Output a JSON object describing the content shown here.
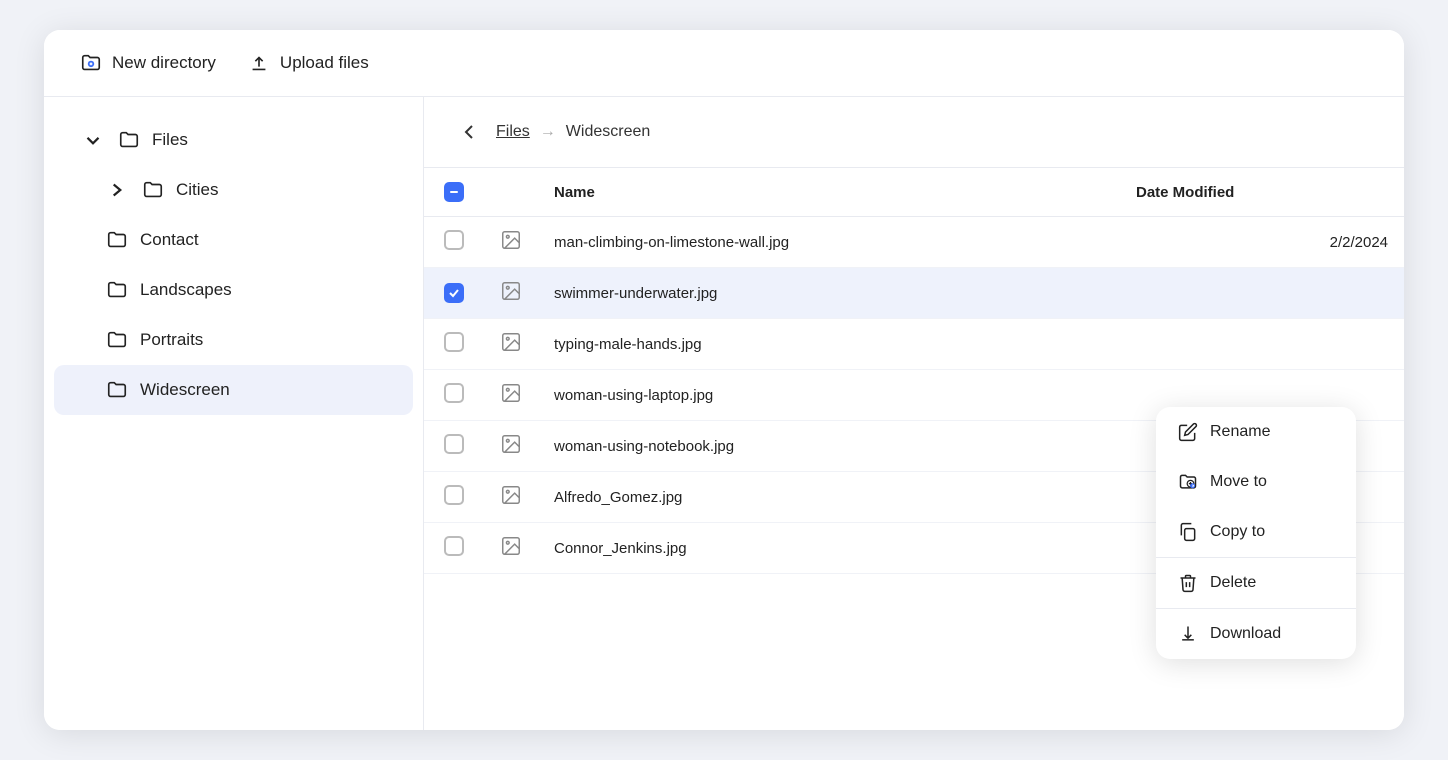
{
  "toolbar": {
    "new_directory_label": "New directory",
    "upload_files_label": "Upload files"
  },
  "sidebar": {
    "files_label": "Files",
    "items": [
      {
        "label": "Cities",
        "indent": 1,
        "active": false
      },
      {
        "label": "Contact",
        "indent": 0,
        "active": false
      },
      {
        "label": "Landscapes",
        "indent": 0,
        "active": false
      },
      {
        "label": "Portraits",
        "indent": 0,
        "active": false
      },
      {
        "label": "Widescreen",
        "indent": 0,
        "active": true
      }
    ]
  },
  "breadcrumb": {
    "back_label": "Back",
    "root_label": "Files",
    "current_label": "Widescreen"
  },
  "table": {
    "col_name": "Name",
    "col_date": "Date Modified",
    "rows": [
      {
        "name": "man-climbing-on-limestone-wall.jpg",
        "date": "2/2/2024",
        "checked": false
      },
      {
        "name": "swimmer-underwater.jpg",
        "date": "",
        "checked": true
      },
      {
        "name": "typing-male-hands.jpg",
        "date": "",
        "checked": false
      },
      {
        "name": "woman-using-laptop.jpg",
        "date": "",
        "checked": false
      },
      {
        "name": "woman-using-notebook.jpg",
        "date": "",
        "checked": false
      },
      {
        "name": "Alfredo_Gomez.jpg",
        "date": "",
        "checked": false
      },
      {
        "name": "Connor_Jenkins.jpg",
        "date": "",
        "checked": false
      }
    ]
  },
  "context_menu": {
    "rename_label": "Rename",
    "move_to_label": "Move to",
    "copy_to_label": "Copy to",
    "delete_label": "Delete",
    "download_label": "Download"
  }
}
